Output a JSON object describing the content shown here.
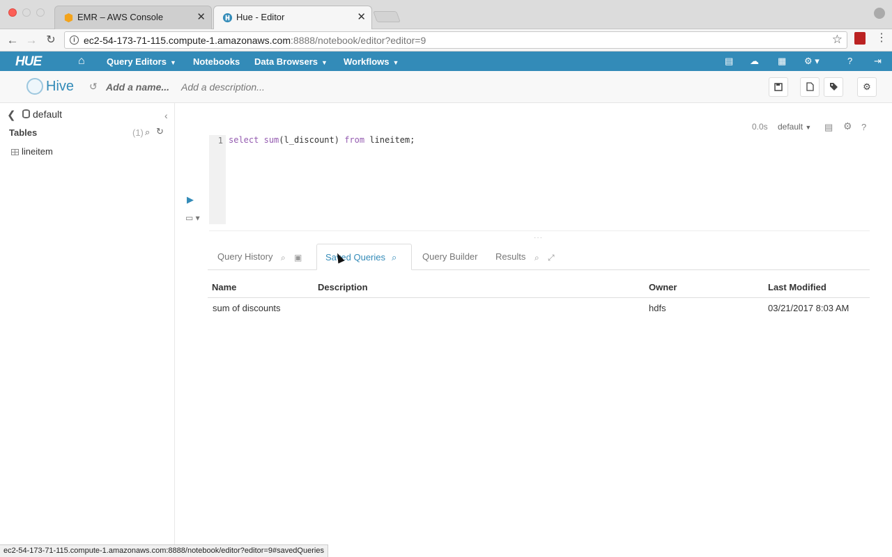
{
  "browser": {
    "tabs": [
      {
        "title": "EMR – AWS Console",
        "close": "✕"
      },
      {
        "title": "Hue - Editor",
        "close": "✕"
      }
    ],
    "url_host": "ec2-54-173-71-115.compute-1.amazonaws.com",
    "url_path": ":8888/notebook/editor?editor=9",
    "status_url": "ec2-54-173-71-115.compute-1.amazonaws.com:8888/notebook/editor?editor=9#savedQueries"
  },
  "hue_nav": {
    "logo": "HUE",
    "items": [
      "Query Editors",
      "Notebooks",
      "Data Browsers",
      "Workflows"
    ]
  },
  "editor_header": {
    "title": "Hive",
    "name_placeholder": "Add a name...",
    "description_placeholder": "Add a description..."
  },
  "left_panel": {
    "database": "default",
    "tables_label": "Tables",
    "tables_count": "(1)",
    "tables": [
      "lineitem"
    ]
  },
  "editor": {
    "exec_time": "0.0s",
    "database": "default",
    "line_number": "1",
    "query_parts": {
      "kw1": "select",
      "fn": "sum",
      "arg": "(l_discount) ",
      "kw2": "from",
      "rest": " lineitem;"
    }
  },
  "result_tabs": [
    "Query History",
    "Saved Queries",
    "Query Builder",
    "Results"
  ],
  "saved_queries": {
    "columns": [
      "Name",
      "Description",
      "Owner",
      "Last Modified"
    ],
    "rows": [
      {
        "name": "sum of discounts",
        "description": "",
        "owner": "hdfs",
        "last_modified": "03/21/2017 8:03 AM"
      }
    ]
  },
  "colors": {
    "accent": "#338bb8",
    "keyword": "#945bb0"
  }
}
